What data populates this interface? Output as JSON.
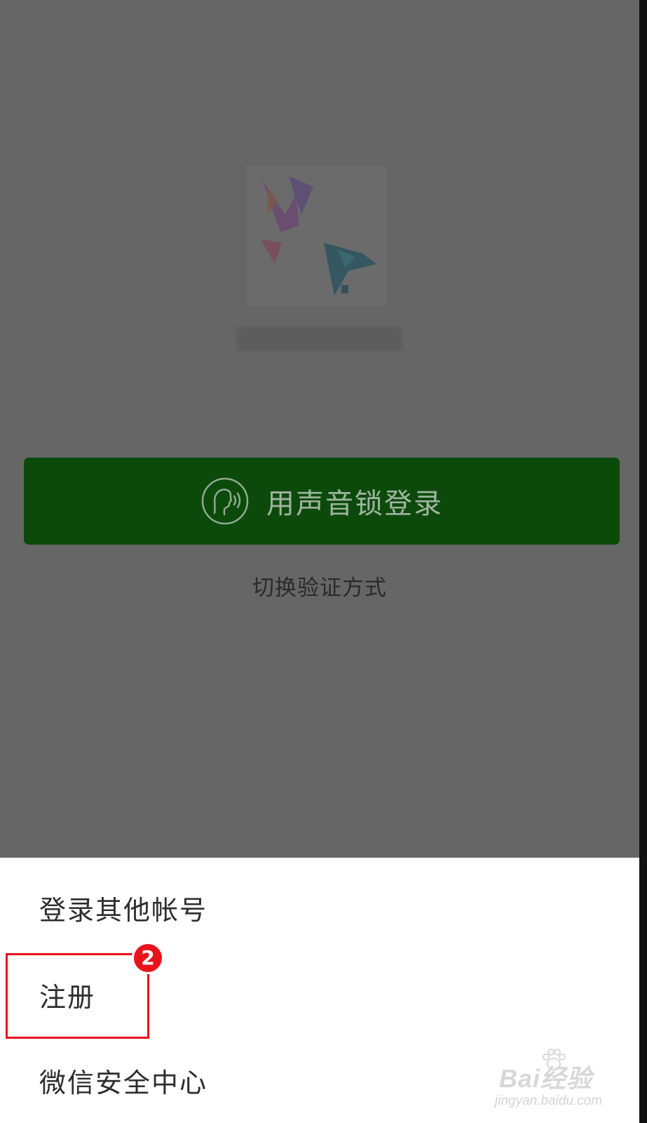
{
  "login": {
    "voice_button_label": "用声音锁登录",
    "switch_verification_label": "切换验证方式"
  },
  "action_sheet": {
    "items": [
      {
        "label": "登录其他帐号"
      },
      {
        "label": "注册"
      },
      {
        "label": "微信安全中心"
      }
    ]
  },
  "annotation": {
    "step_number": "2"
  },
  "watermark": {
    "logo_text": "Bai经验",
    "url": "jingyan.baidu.com"
  },
  "colors": {
    "overlay": "#666666",
    "voice_button": "#0c4a0c",
    "highlight": "#e8141c",
    "sheet_background": "#ffffff"
  },
  "icons": {
    "voice": "voice-lock-icon",
    "avatar": "user-avatar",
    "watermark": "baidu-paw-icon"
  }
}
